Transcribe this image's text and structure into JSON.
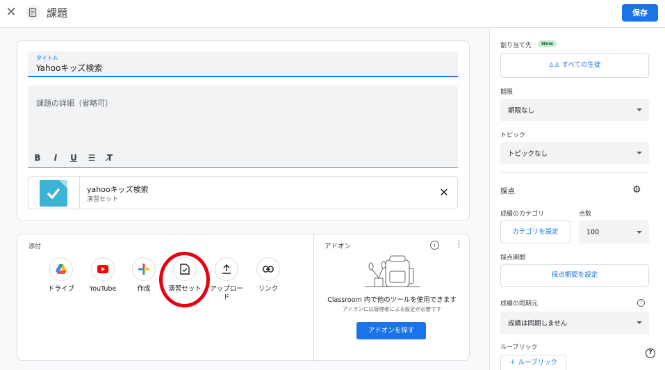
{
  "topbar": {
    "title": "課題",
    "save_label": "保存"
  },
  "assignment": {
    "title_label": "タイトル",
    "title_value": "Yahooキッズ検索",
    "details_placeholder": "課題の詳細（省略可）",
    "format_buttons": [
      "B",
      "I",
      "U",
      "☰",
      "T̸"
    ]
  },
  "attachment_item": {
    "name": "yahooキッズ検索",
    "type": "演習セット"
  },
  "attach": {
    "label": "添付",
    "buttons": [
      {
        "label": "ドライブ",
        "icon": "drive-icon"
      },
      {
        "label": "YouTube",
        "icon": "youtube-icon"
      },
      {
        "label": "作成",
        "icon": "create-plus-icon"
      },
      {
        "label": "演習セット",
        "icon": "practice-set-icon"
      },
      {
        "label": "アップロード",
        "icon": "upload-icon"
      },
      {
        "label": "リンク",
        "icon": "link-icon"
      }
    ]
  },
  "addons": {
    "title": "アドオン",
    "main_text": "Classroom 内で他のツールを使用できます",
    "sub_text": "アドオンには管理者による設定が必要です",
    "button_label": "アドオンを探す"
  },
  "sidebar": {
    "assign_to_label": "割り当て先",
    "new_badge": "New",
    "all_students": "すべての生徒",
    "due_label": "期限",
    "due_value": "期限なし",
    "topic_label": "トピック",
    "topic_value": "トピックなし",
    "grading_heading": "採点",
    "grade_category_label": "成績のカテゴリ",
    "points_label": "点数",
    "set_category_button": "カテゴリを設定",
    "points_value": "100",
    "grading_period_label": "採点期間",
    "set_grading_period_button": "採点期間を設定",
    "grade_sync_label": "成績の同期元",
    "grade_sync_value": "成績は同期しません",
    "rubric_label": "ルーブリック",
    "rubric_button": "ルーブリック"
  },
  "colors": {
    "primary": "#1a73e8",
    "highlight_ring": "#e50012",
    "practice_set_thumb": "#3cb4d3"
  }
}
